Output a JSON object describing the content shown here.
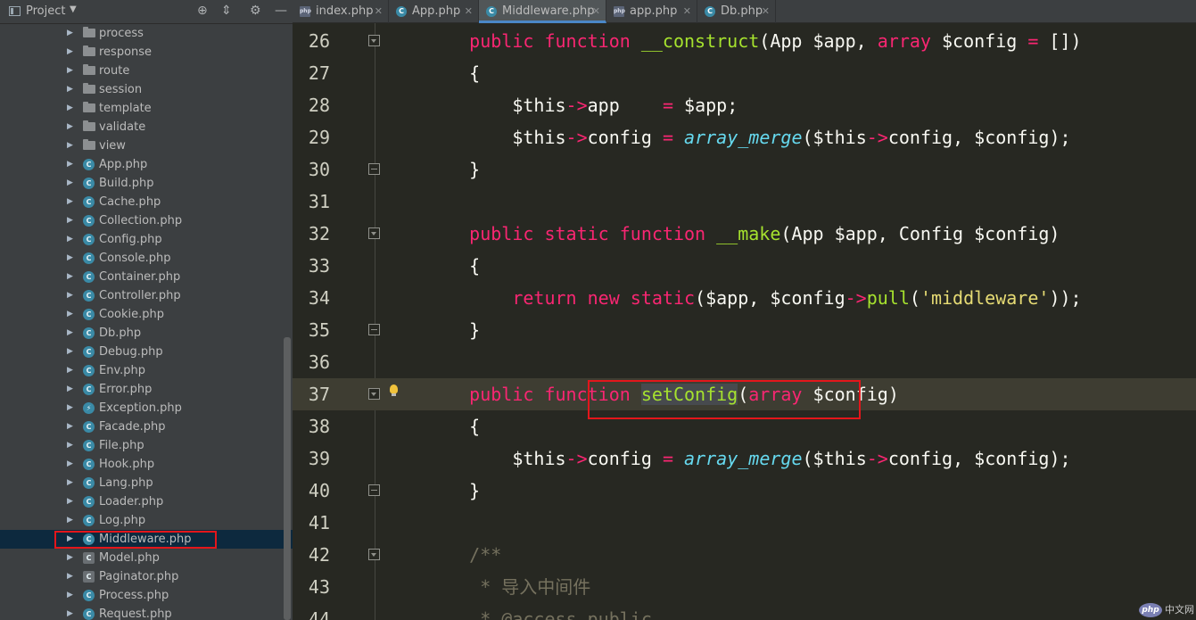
{
  "sidebar": {
    "title": "Project",
    "header_icons": [
      "crosshair-icon",
      "collapse-icon",
      "gear-icon",
      "minimize-icon"
    ],
    "items": [
      {
        "label": "process",
        "type": "folder"
      },
      {
        "label": "response",
        "type": "folder"
      },
      {
        "label": "route",
        "type": "folder"
      },
      {
        "label": "session",
        "type": "folder"
      },
      {
        "label": "template",
        "type": "folder"
      },
      {
        "label": "validate",
        "type": "folder"
      },
      {
        "label": "view",
        "type": "folder"
      },
      {
        "label": "App.php",
        "type": "class"
      },
      {
        "label": "Build.php",
        "type": "class"
      },
      {
        "label": "Cache.php",
        "type": "class"
      },
      {
        "label": "Collection.php",
        "type": "class"
      },
      {
        "label": "Config.php",
        "type": "class"
      },
      {
        "label": "Console.php",
        "type": "class"
      },
      {
        "label": "Container.php",
        "type": "class"
      },
      {
        "label": "Controller.php",
        "type": "class"
      },
      {
        "label": "Cookie.php",
        "type": "class"
      },
      {
        "label": "Db.php",
        "type": "class"
      },
      {
        "label": "Debug.php",
        "type": "class"
      },
      {
        "label": "Env.php",
        "type": "class"
      },
      {
        "label": "Error.php",
        "type": "class"
      },
      {
        "label": "Exception.php",
        "type": "exception"
      },
      {
        "label": "Facade.php",
        "type": "class"
      },
      {
        "label": "File.php",
        "type": "class"
      },
      {
        "label": "Hook.php",
        "type": "class"
      },
      {
        "label": "Lang.php",
        "type": "class"
      },
      {
        "label": "Loader.php",
        "type": "class"
      },
      {
        "label": "Log.php",
        "type": "class"
      },
      {
        "label": "Middleware.php",
        "type": "class",
        "selected": true
      },
      {
        "label": "Model.php",
        "type": "abstract"
      },
      {
        "label": "Paginator.php",
        "type": "abstract"
      },
      {
        "label": "Process.php",
        "type": "class"
      },
      {
        "label": "Request.php",
        "type": "class"
      }
    ]
  },
  "tabs": [
    {
      "label": "index.php",
      "icon": "php",
      "active": false
    },
    {
      "label": "App.php",
      "icon": "class",
      "active": false
    },
    {
      "label": "Middleware.php",
      "icon": "class",
      "active": true
    },
    {
      "label": "app.php",
      "icon": "php",
      "active": false
    },
    {
      "label": "Db.php",
      "icon": "class",
      "active": false
    }
  ],
  "editor": {
    "current_line": 37,
    "lines": [
      {
        "n": "26",
        "fold": "open",
        "tokens": [
          [
            "    ",
            ""
          ],
          [
            "public",
            "kw"
          ],
          [
            " ",
            ""
          ],
          [
            "function",
            "kw"
          ],
          [
            " ",
            ""
          ],
          [
            "__construct",
            "fn"
          ],
          [
            "(App $app, ",
            ""
          ],
          [
            "array",
            "kw"
          ],
          [
            " $config ",
            ""
          ],
          [
            "=",
            "kw"
          ],
          [
            " [])",
            ""
          ]
        ]
      },
      {
        "n": "27",
        "fold": "",
        "tokens": [
          [
            "    {",
            ""
          ]
        ]
      },
      {
        "n": "28",
        "fold": "",
        "tokens": [
          [
            "        $this",
            ""
          ],
          [
            "->",
            "kw"
          ],
          [
            "app    ",
            ""
          ],
          [
            "=",
            "kw"
          ],
          [
            " $app;",
            ""
          ]
        ]
      },
      {
        "n": "29",
        "fold": "",
        "tokens": [
          [
            "        $this",
            ""
          ],
          [
            "->",
            "kw"
          ],
          [
            "config ",
            ""
          ],
          [
            "=",
            "kw"
          ],
          [
            " ",
            ""
          ],
          [
            "array_merge",
            "bi"
          ],
          [
            "($this",
            ""
          ],
          [
            "->",
            "kw"
          ],
          [
            "config, $config);",
            ""
          ]
        ]
      },
      {
        "n": "30",
        "fold": "close",
        "tokens": [
          [
            "    }",
            ""
          ]
        ]
      },
      {
        "n": "31",
        "fold": "",
        "tokens": []
      },
      {
        "n": "32",
        "fold": "open",
        "tokens": [
          [
            "    ",
            ""
          ],
          [
            "public",
            "kw"
          ],
          [
            " ",
            ""
          ],
          [
            "static",
            "kw"
          ],
          [
            " ",
            ""
          ],
          [
            "function",
            "kw"
          ],
          [
            " ",
            ""
          ],
          [
            "__make",
            "fn"
          ],
          [
            "(App $app, Config $config)",
            ""
          ]
        ]
      },
      {
        "n": "33",
        "fold": "",
        "tokens": [
          [
            "    {",
            ""
          ]
        ]
      },
      {
        "n": "34",
        "fold": "",
        "tokens": [
          [
            "        ",
            ""
          ],
          [
            "return",
            "kw"
          ],
          [
            " ",
            ""
          ],
          [
            "new",
            "kw"
          ],
          [
            " ",
            ""
          ],
          [
            "static",
            "kw"
          ],
          [
            "($app, $config",
            ""
          ],
          [
            "->",
            "kw"
          ],
          [
            "pull",
            "fn"
          ],
          [
            "(",
            ""
          ],
          [
            "'middleware'",
            "str"
          ],
          [
            "));",
            ""
          ]
        ]
      },
      {
        "n": "35",
        "fold": "close",
        "tokens": [
          [
            "    }",
            ""
          ]
        ]
      },
      {
        "n": "36",
        "fold": "",
        "tokens": []
      },
      {
        "n": "37",
        "fold": "open",
        "bulb": true,
        "tokens": [
          [
            "    ",
            ""
          ],
          [
            "public",
            "kw"
          ],
          [
            " ",
            ""
          ],
          [
            "function",
            "kw"
          ],
          [
            " ",
            ""
          ],
          [
            "setConfig",
            "fn hl"
          ],
          [
            "(",
            ""
          ],
          [
            "array",
            "kw"
          ],
          [
            " $config)",
            ""
          ]
        ]
      },
      {
        "n": "38",
        "fold": "",
        "tokens": [
          [
            "    {",
            ""
          ]
        ]
      },
      {
        "n": "39",
        "fold": "",
        "tokens": [
          [
            "        $this",
            ""
          ],
          [
            "->",
            "kw"
          ],
          [
            "config ",
            ""
          ],
          [
            "=",
            "kw"
          ],
          [
            " ",
            ""
          ],
          [
            "array_merge",
            "bi"
          ],
          [
            "($this",
            ""
          ],
          [
            "->",
            "kw"
          ],
          [
            "config, $config);",
            ""
          ]
        ]
      },
      {
        "n": "40",
        "fold": "close",
        "tokens": [
          [
            "    }",
            ""
          ]
        ]
      },
      {
        "n": "41",
        "fold": "",
        "tokens": []
      },
      {
        "n": "42",
        "fold": "open",
        "tokens": [
          [
            "    /**",
            "cm"
          ]
        ]
      },
      {
        "n": "43",
        "fold": "",
        "tokens": [
          [
            "     * 导入中间件",
            "cm"
          ]
        ]
      },
      {
        "n": "44",
        "fold": "",
        "tokens": [
          [
            "     * @access public",
            "cm"
          ]
        ]
      }
    ]
  },
  "watermark": {
    "logo": "php",
    "text": "中文网"
  },
  "colors": {
    "keyword": "#f92672",
    "function": "#a6e22e",
    "builtin": "#66d9ef",
    "string": "#e6db74",
    "comment": "#75715e",
    "annotation_box": "#e3161b"
  }
}
